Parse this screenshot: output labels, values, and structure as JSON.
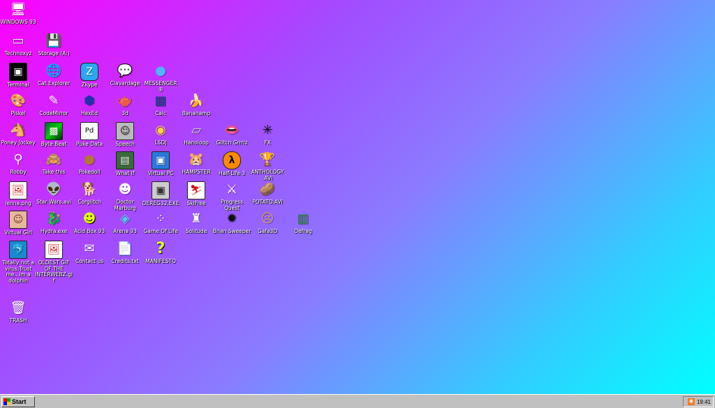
{
  "desktop": {
    "icons": [
      {
        "label": "WINDOWS 93",
        "glyph": "🖥"
      },
      {
        "label": "Technoxyz",
        "glyph": "▭"
      },
      {
        "label": "Storage (A:)",
        "glyph": "💾"
      },
      {
        "label": "Terminal",
        "glyph": "▣"
      },
      {
        "label": "Cat Explorer",
        "glyph": "🌐"
      },
      {
        "label": "Zkype",
        "glyph": "Z"
      },
      {
        "label": "Clavardage",
        "glyph": "💬"
      },
      {
        "label": "MESSENGER ®",
        "glyph": "●"
      },
      {
        "label": "Piskel",
        "glyph": "🎨"
      },
      {
        "label": "CodeMirror",
        "glyph": "✎"
      },
      {
        "label": "HexEd",
        "glyph": "⬢"
      },
      {
        "label": "3d",
        "glyph": "🫖"
      },
      {
        "label": "Calc",
        "glyph": "▦"
      },
      {
        "label": "Bananamp",
        "glyph": "🍌"
      },
      {
        "label": "Poney Jockey",
        "glyph": "🐴"
      },
      {
        "label": "Byte Beat",
        "glyph": "▩"
      },
      {
        "label": "Puke Data",
        "glyph": "Pd"
      },
      {
        "label": "Speech",
        "glyph": "☺"
      },
      {
        "label": "LSDJ",
        "glyph": "◉"
      },
      {
        "label": "Hanoloop",
        "glyph": "▱"
      },
      {
        "label": "Glitch Grrrlz",
        "glyph": "👄"
      },
      {
        "label": "FX",
        "glyph": "✳"
      },
      {
        "label": "Robby",
        "glyph": "⚲"
      },
      {
        "label": "Take this",
        "glyph": "🙈"
      },
      {
        "label": "Pokedoll",
        "glyph": "●"
      },
      {
        "label": "What If",
        "glyph": "▤"
      },
      {
        "label": "Virtual PC",
        "glyph": "▣"
      },
      {
        "label": "HAMPSTER",
        "glyph": "🐹"
      },
      {
        "label": "Half-Life 3",
        "glyph": "λ"
      },
      {
        "label": "ANTHOLOGY .AVI",
        "glyph": "🏆"
      },
      {
        "label": "lenna.png",
        "glyph": "🖼"
      },
      {
        "label": "Star Wars.avi",
        "glyph": "👽"
      },
      {
        "label": "Corglitch",
        "glyph": "🐕"
      },
      {
        "label": "Doctor Marburg",
        "glyph": "☻"
      },
      {
        "label": "DEREG32.EXE",
        "glyph": "▣"
      },
      {
        "label": "SkiFree",
        "glyph": "⛷"
      },
      {
        "label": "Progress Quest",
        "glyph": "⚔"
      },
      {
        "label": "POTATO.AVI",
        "glyph": "🥔"
      },
      {
        "label": "Virtual Girl",
        "glyph": "☺"
      },
      {
        "label": "Hydra.exe",
        "glyph": "🐉"
      },
      {
        "label": "Acid Box 93",
        "glyph": "☻"
      },
      {
        "label": "Arena 93",
        "glyph": "◈"
      },
      {
        "label": "Game Of Life",
        "glyph": "⁘"
      },
      {
        "label": "Solitude",
        "glyph": "♜"
      },
      {
        "label": "Brian Sweeper",
        "glyph": "✹"
      },
      {
        "label": "Gafa3D",
        "glyph": "☹"
      },
      {
        "label": "Defrag",
        "glyph": "▥"
      },
      {
        "label": "Totally not a virus.Trust me...im a dolphin",
        "glyph": "🐬"
      },
      {
        "label": "OLDEST GIF OF THE INTERWEBZ.gif",
        "glyph": "🖼"
      },
      {
        "label": "Contact us",
        "glyph": "✉"
      },
      {
        "label": "Credits.txt",
        "glyph": "📄"
      },
      {
        "label": "MANIFESTO",
        "glyph": "?"
      },
      {
        "label": "TRASH",
        "glyph": "🗑"
      }
    ]
  },
  "taskbar": {
    "start_label": "Start",
    "clock": "19:41",
    "tray_icon": "rss-icon"
  }
}
